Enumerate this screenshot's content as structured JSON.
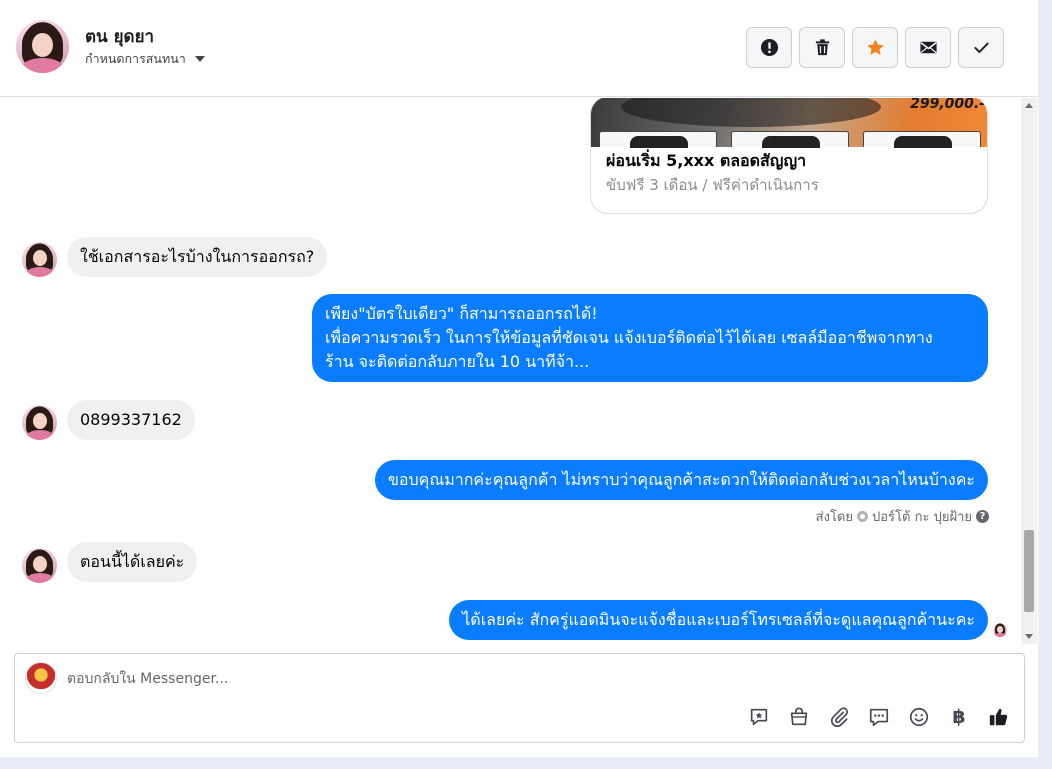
{
  "header": {
    "contact_name": "ตน ยุดยา",
    "assign_label": "กำหนดการสนทนา",
    "toolbar": [
      {
        "icon": "alert-icon",
        "name": "mark-spam-button"
      },
      {
        "icon": "trash-icon",
        "name": "delete-button"
      },
      {
        "icon": "star-icon",
        "name": "star-button"
      },
      {
        "icon": "mail-icon",
        "name": "mark-unread-button"
      },
      {
        "icon": "check-icon",
        "name": "mark-done-button"
      }
    ]
  },
  "card": {
    "price": "299,000.-",
    "title": "ผ่อนเริ่ม 5,xxx ตลอดสัญญา",
    "description": "ขับฟรี 3 เดือน / ฟรีค่าดำเนินการ"
  },
  "messages": [
    {
      "direction": "in",
      "text": "ใช้เอกสารอะไรบ้างในการออกรถ?"
    },
    {
      "direction": "out",
      "text": "เพียง\"บัตรใบเดียว\" ก็สามารถออกรถได้!\nเพื่อความรวดเร็ว ในการให้ข้อมูลที่ชัดเจน แจ้งเบอร์ติดต่อไว้ได้เลย เซลล์มืออาชีพจากทาง\nร้าน จะติดต่อกลับภายใน 10 นาทีจ้า..."
    },
    {
      "direction": "in",
      "text": "0899337162"
    },
    {
      "direction": "out",
      "text": "ขอบคุณมากค่ะคุณลูกค้า ไม่ทราบว่าคุณลูกค้าสะดวกให้ติดต่อกลับช่วงเวลาไหนบ้างคะ"
    },
    {
      "direction": "in",
      "text": "ตอนนี้ได้เลยค่ะ"
    },
    {
      "direction": "out",
      "text": "ได้เลยค่ะ สักครู่แอดมินจะแจ้งชื่อและเบอร์โทรเซลล์ที่จะดูแลคุณลูกค้านะคะ"
    }
  ],
  "sent_by": {
    "prefix": "ส่งโดย",
    "name": "ปอร์โต้ กะ ปุยฝ้าย"
  },
  "composer": {
    "placeholder": "ตอบกลับใน Messenger...",
    "currency_symbol": "฿",
    "tools": [
      "saved-reply-icon",
      "shop-bag-icon",
      "attachment-icon",
      "chat-bubble-icon",
      "emoji-icon",
      "baht-icon",
      "like-icon"
    ]
  },
  "colors": {
    "outgoing_bubble": "#0a7cff",
    "incoming_bubble": "#f0f0f0",
    "star": "#f58220"
  }
}
